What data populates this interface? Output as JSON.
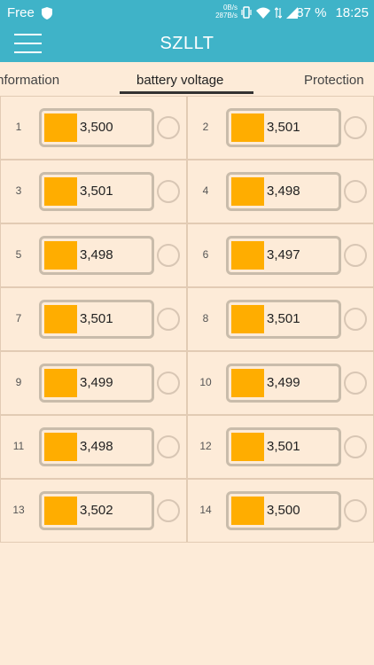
{
  "status_bar": {
    "carrier": "Free",
    "speed_up": "0B/s",
    "speed_down": "287B/s",
    "battery": "87 %",
    "time": "18:25"
  },
  "app": {
    "title": "SZLLT"
  },
  "tabs": [
    {
      "label": "Information",
      "active": false
    },
    {
      "label": "battery voltage",
      "active": true
    },
    {
      "label": "Protection",
      "active": false
    }
  ],
  "cells": [
    {
      "index": "1",
      "value": "3,500"
    },
    {
      "index": "2",
      "value": "3,501"
    },
    {
      "index": "3",
      "value": "3,501"
    },
    {
      "index": "4",
      "value": "3,498"
    },
    {
      "index": "5",
      "value": "3,498"
    },
    {
      "index": "6",
      "value": "3,497"
    },
    {
      "index": "7",
      "value": "3,501"
    },
    {
      "index": "8",
      "value": "3,501"
    },
    {
      "index": "9",
      "value": "3,499"
    },
    {
      "index": "10",
      "value": "3,499"
    },
    {
      "index": "11",
      "value": "3,498"
    },
    {
      "index": "12",
      "value": "3,501"
    },
    {
      "index": "13",
      "value": "3,502"
    },
    {
      "index": "14",
      "value": "3,500"
    }
  ],
  "colors": {
    "header": "#3fb3c8",
    "background": "#fdebd8",
    "battery_fill": "#ffad00"
  }
}
